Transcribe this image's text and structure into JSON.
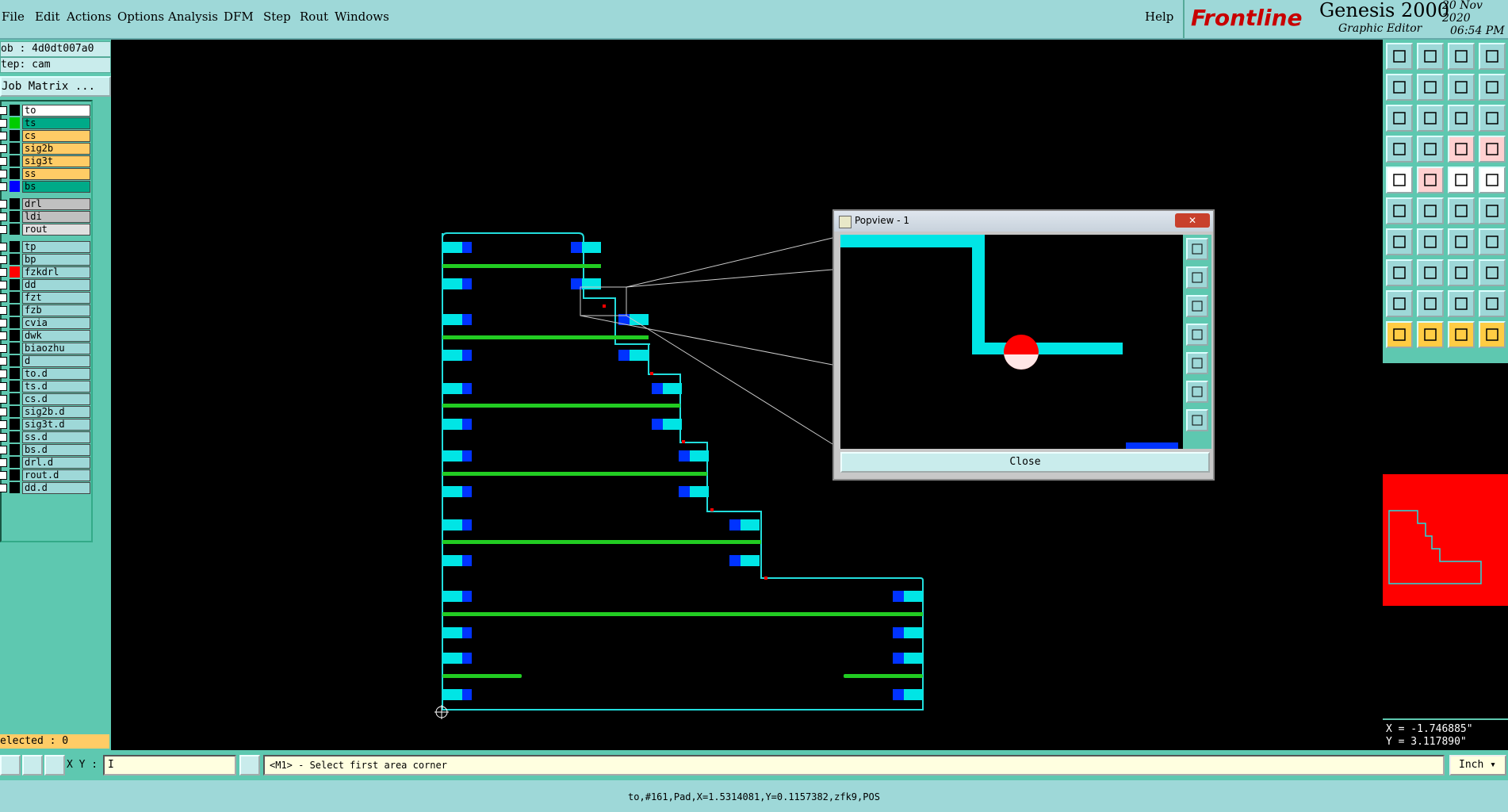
{
  "menu": {
    "items": [
      "File",
      "Edit",
      "Actions",
      "Options",
      "Analysis",
      "DFM",
      "Step",
      "Rout",
      "Windows"
    ],
    "help": "Help"
  },
  "brand": {
    "logo": "Frontline",
    "product": "Genesis 2000",
    "subtitle": "Graphic Editor",
    "date": "20 Nov 2020",
    "time": "06:54 PM"
  },
  "left": {
    "job": "ob : 4d0dt007a0",
    "step": "tep: cam",
    "job_matrix": "Job Matrix ...",
    "layers": [
      {
        "name": "to",
        "swatch": "#000000",
        "fill": "#ffffff"
      },
      {
        "name": "ts",
        "swatch": "#00cc00",
        "fill": "#00aa88"
      },
      {
        "name": "cs",
        "swatch": "#000000",
        "fill": "#ffcc66"
      },
      {
        "name": "sig2b",
        "swatch": "#000000",
        "fill": "#ffcc66"
      },
      {
        "name": "sig3t",
        "swatch": "#000000",
        "fill": "#ffcc66"
      },
      {
        "name": "ss",
        "swatch": "#000000",
        "fill": "#ffcc66"
      },
      {
        "name": "bs",
        "swatch": "#0000ff",
        "fill": "#00aa88"
      },
      {
        "name": "drl",
        "swatch": "#000000",
        "fill": "#c0c0c0"
      },
      {
        "name": "ldi",
        "swatch": "#000000",
        "fill": "#c0c0c0"
      },
      {
        "name": "rout",
        "swatch": "#000000",
        "fill": "#e0e0e0"
      },
      {
        "name": "tp",
        "swatch": "#000000",
        "fill": "#9ed8d8"
      },
      {
        "name": "bp",
        "swatch": "#000000",
        "fill": "#9ed8d8"
      },
      {
        "name": "fzkdrl",
        "swatch": "#ff0000",
        "fill": "#9ed8d8"
      },
      {
        "name": "dd",
        "swatch": "#000000",
        "fill": "#9ed8d8"
      },
      {
        "name": "fzt",
        "swatch": "#000000",
        "fill": "#9ed8d8"
      },
      {
        "name": "fzb",
        "swatch": "#000000",
        "fill": "#9ed8d8"
      },
      {
        "name": "cvia",
        "swatch": "#000000",
        "fill": "#9ed8d8"
      },
      {
        "name": "dwk",
        "swatch": "#000000",
        "fill": "#9ed8d8"
      },
      {
        "name": "biaozhu",
        "swatch": "#000000",
        "fill": "#9ed8d8"
      },
      {
        "name": "d",
        "swatch": "#000000",
        "fill": "#9ed8d8"
      },
      {
        "name": "to.d",
        "swatch": "#000000",
        "fill": "#9ed8d8"
      },
      {
        "name": "ts.d",
        "swatch": "#000000",
        "fill": "#9ed8d8"
      },
      {
        "name": "cs.d",
        "swatch": "#000000",
        "fill": "#9ed8d8"
      },
      {
        "name": "sig2b.d",
        "swatch": "#000000",
        "fill": "#9ed8d8"
      },
      {
        "name": "sig3t.d",
        "swatch": "#000000",
        "fill": "#9ed8d8"
      },
      {
        "name": "ss.d",
        "swatch": "#000000",
        "fill": "#9ed8d8"
      },
      {
        "name": "bs.d",
        "swatch": "#000000",
        "fill": "#9ed8d8"
      },
      {
        "name": "drl.d",
        "swatch": "#000000",
        "fill": "#9ed8d8"
      },
      {
        "name": "rout.d",
        "swatch": "#000000",
        "fill": "#9ed8d8"
      },
      {
        "name": "dd.d",
        "swatch": "#000000",
        "fill": "#9ed8d8"
      }
    ],
    "selected": "elected : 0"
  },
  "popview": {
    "title": "Popview - 1",
    "close_label": "Close",
    "close_x": "✕"
  },
  "coords": {
    "x": "X = -1.746885\"",
    "y": "Y = 3.117890\""
  },
  "bottom": {
    "xy_label": "X Y :",
    "xy_value": "I",
    "prompt": "<M1> - Select first area corner",
    "unit": "Inch ▾"
  },
  "status": {
    "text": "to,#161,Pad,X=1.5314081,Y=0.1157382,zfk9,POS"
  },
  "colors": {
    "outline": "#22dddd",
    "pad_cyan": "#00e5e5",
    "pad_blue": "#0033ff",
    "trace_green": "#22cc22",
    "marker_red": "#ff0000"
  }
}
